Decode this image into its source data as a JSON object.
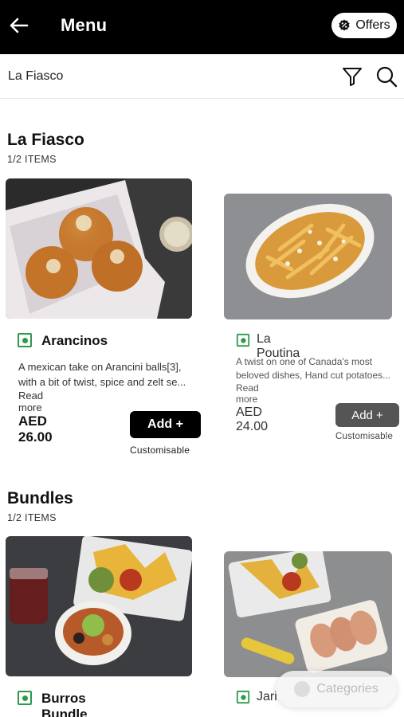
{
  "header": {
    "title": "Menu",
    "offers_label": "Offers"
  },
  "subheader": {
    "restaurant_name": "La Fiasco"
  },
  "sections": [
    {
      "title": "La Fiasco",
      "count": "1/2 ITEMS",
      "items": [
        {
          "name": "Arancinos",
          "desc_line1": "A mexican take on Arancini balls[3],",
          "desc_line2": "with a bit of twist, spice and zelt se...",
          "read_more": "Read more",
          "price": "AED 26.00",
          "add_label": "Add +",
          "customisable": "Customisable"
        },
        {
          "name": "La Poutina",
          "desc_line1": "A twist on one of Canada's most",
          "desc_line2": "beloved dishes, Hand cut potatoes...",
          "read_more": "Read more",
          "price": "AED 24.00",
          "add_label": "Add +",
          "customisable": "Customisable"
        }
      ]
    },
    {
      "title": "Bundles",
      "count": "1/2 ITEMS",
      "items": [
        {
          "name": "Burros Bundle"
        },
        {
          "name": "Jari"
        }
      ]
    }
  ],
  "categories_label": "Categories",
  "colors": {
    "veg": "#2e9a4e",
    "topbar": "#000000"
  }
}
